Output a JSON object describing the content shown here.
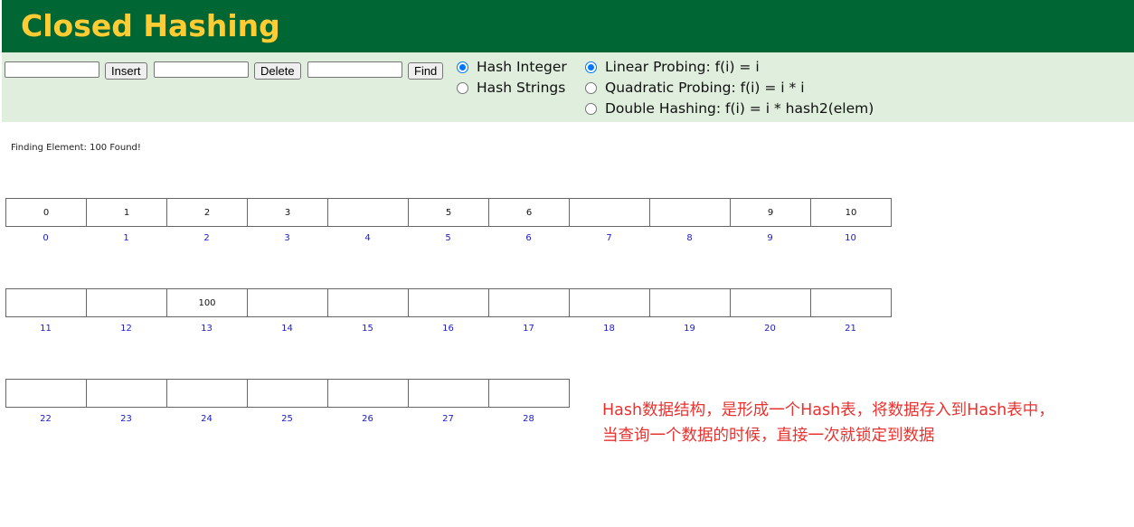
{
  "header": {
    "title": "Closed Hashing"
  },
  "toolbar": {
    "insert_value": "",
    "insert_label": "Insert",
    "delete_value": "",
    "delete_label": "Delete",
    "find_value": "",
    "find_label": "Find",
    "hash_types": [
      {
        "label": "Hash Integer",
        "checked": true
      },
      {
        "label": "Hash Strings",
        "checked": false
      }
    ],
    "probing": [
      {
        "label": "Linear Probing: f(i) = i",
        "checked": true
      },
      {
        "label": "Quadratic Probing: f(i) = i * i",
        "checked": false
      },
      {
        "label": "Double Hashing: f(i) = i * hash2(elem)",
        "checked": false
      }
    ]
  },
  "status": "Finding Element: 100  Found!",
  "table": {
    "rows": [
      {
        "values": [
          "0",
          "1",
          "2",
          "3",
          "",
          "5",
          "6",
          "",
          "",
          "9",
          "10"
        ],
        "indices": [
          "0",
          "1",
          "2",
          "3",
          "4",
          "5",
          "6",
          "7",
          "8",
          "9",
          "10"
        ]
      },
      {
        "values": [
          "",
          "",
          "100",
          "",
          "",
          "",
          "",
          "",
          "",
          "",
          ""
        ],
        "indices": [
          "11",
          "12",
          "13",
          "14",
          "15",
          "16",
          "17",
          "18",
          "19",
          "20",
          "21"
        ]
      },
      {
        "values": [
          "",
          "",
          "",
          "",
          "",
          "",
          ""
        ],
        "indices": [
          "22",
          "23",
          "24",
          "25",
          "26",
          "27",
          "28"
        ]
      }
    ]
  },
  "annotation": {
    "line1": "Hash数据结构，是形成一个Hash表，将数据存入到Hash表中，",
    "line2": "当查询一个数据的时候，直接一次就锁定到数据"
  },
  "colors": {
    "header_bg": "#006633",
    "title": "#ffcc33",
    "toolbar_bg": "#dfeedd",
    "index_text": "#1a1acc",
    "annotation": "#e8322f"
  }
}
